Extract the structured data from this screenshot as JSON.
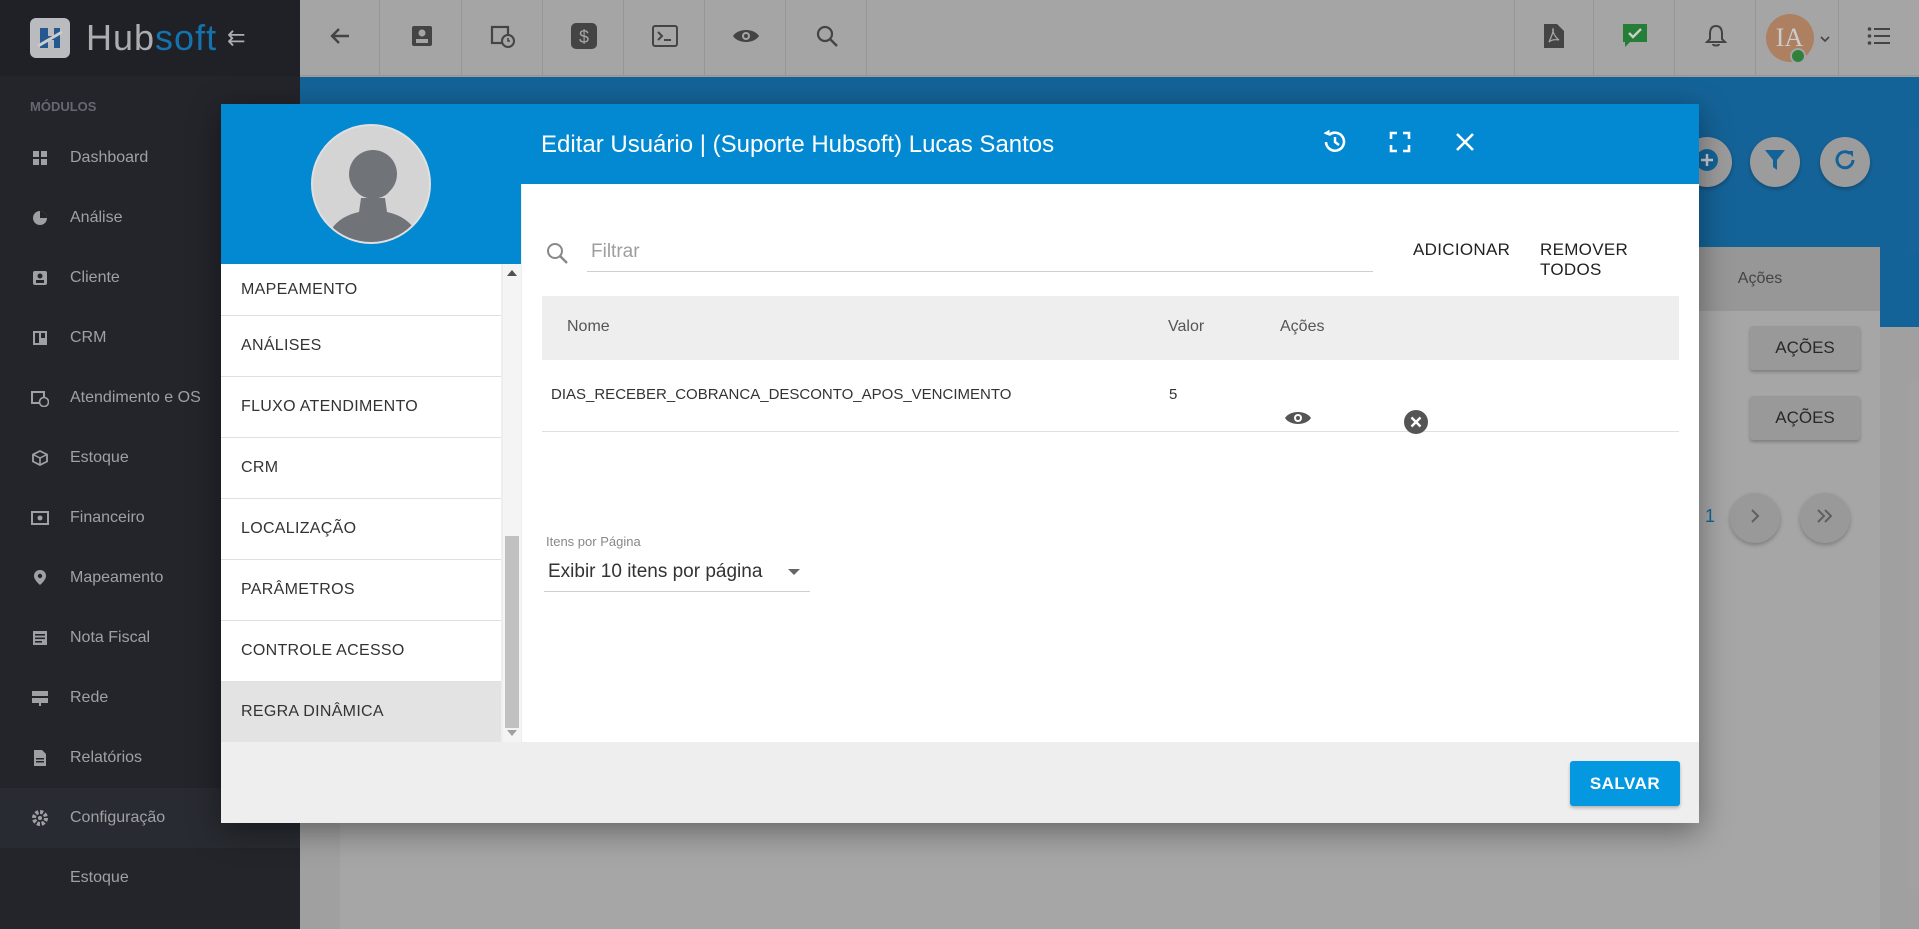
{
  "app": {
    "logo_text_main": "Hub",
    "logo_text_accent": "soft"
  },
  "sidebar": {
    "section_title": "MÓDULOS",
    "items": [
      {
        "label": "Dashboard",
        "icon": "dashboard-icon"
      },
      {
        "label": "Análise",
        "icon": "pie-chart-icon"
      },
      {
        "label": "Cliente",
        "icon": "contact-icon"
      },
      {
        "label": "CRM",
        "icon": "board-icon"
      },
      {
        "label": "Atendimento e OS",
        "icon": "calendar-clock-icon"
      },
      {
        "label": "Estoque",
        "icon": "box-icon"
      },
      {
        "label": "Financeiro",
        "icon": "money-icon"
      },
      {
        "label": "Mapeamento",
        "icon": "map-pin-icon"
      },
      {
        "label": "Nota Fiscal",
        "icon": "document-icon"
      },
      {
        "label": "Rede",
        "icon": "server-icon"
      },
      {
        "label": "Relatórios",
        "icon": "report-icon"
      },
      {
        "label": "Configuração",
        "icon": "gear-icon"
      },
      {
        "label": "Estoque",
        "icon": ""
      }
    ]
  },
  "topbar": {
    "avatar_initials": "IA"
  },
  "background": {
    "table_head_actions": "Ações",
    "row_action_label": "AÇÕES",
    "page_text": ": 1"
  },
  "modal": {
    "title": "Editar Usuário | (Suporte Hubsoft) Lucas Santos",
    "menu": [
      "MAPEAMENTO",
      "ANÁLISES",
      "FLUXO ATENDIMENTO",
      "CRM",
      "LOCALIZAÇÃO",
      "PARÂMETROS",
      "CONTROLE ACESSO",
      "REGRA DINÂMICA"
    ],
    "filter": {
      "placeholder": "Filtrar",
      "add_label": "ADICIONAR",
      "remove_all_label": "REMOVER TODOS"
    },
    "table": {
      "headers": {
        "name": "Nome",
        "value": "Valor",
        "actions": "Ações"
      },
      "rows": [
        {
          "name": "DIAS_RECEBER_COBRANCA_DESCONTO_APOS_VENCIMENTO",
          "value": "5"
        }
      ]
    },
    "pagination": {
      "label": "Itens por Página",
      "selected": "Exibir 10 itens por página"
    },
    "save_label": "SALVAR"
  },
  "colors": {
    "primary": "#0388d2",
    "save": "#0398e0",
    "sidebar_bg": "#2c2f36"
  }
}
